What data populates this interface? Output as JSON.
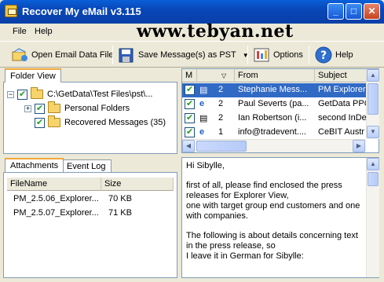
{
  "window": {
    "title": "Recover My eMail v3.115"
  },
  "watermark": "www.tebyan.net",
  "menu": {
    "file": "File",
    "help": "Help"
  },
  "toolbar": {
    "open": "Open Email Data File",
    "save": "Save Message(s) as PST",
    "options": "Options",
    "help": "Help"
  },
  "folder_view": {
    "tab": "Folder View",
    "items": [
      {
        "label": "C:\\GetData\\Test Files\\pst\\..."
      },
      {
        "label": "Personal Folders"
      },
      {
        "label": "Recovered Messages (35)"
      }
    ]
  },
  "messages": {
    "headers": {
      "m": "M",
      "flag": "",
      "from": "From",
      "subject": "Subject"
    },
    "rows": [
      {
        "count": "2",
        "from": "Stephanie Mess...",
        "subject": "PM Explorer",
        "icon": "document-icon",
        "selected": true
      },
      {
        "count": "2",
        "from": "Paul Severts (pa...",
        "subject": "GetData PPC",
        "icon": "ie-icon",
        "selected": false
      },
      {
        "count": "2",
        "from": "Ian Robertson (i...",
        "subject": "second InDe",
        "icon": "document-icon",
        "selected": false
      },
      {
        "count": "1",
        "from": "info@tradevent....",
        "subject": "CeBIT Austr",
        "icon": "ie-icon",
        "selected": false
      }
    ]
  },
  "attachments": {
    "tabs": [
      "Attachments",
      "Event Log"
    ],
    "headers": {
      "filename": "FileName",
      "size": "Size"
    },
    "rows": [
      {
        "filename": "PM_2.5.06_Explorer...",
        "size": "70 KB"
      },
      {
        "filename": "PM_2.5.07_Explorer...",
        "size": "71 KB"
      }
    ]
  },
  "preview": {
    "lines": [
      "Hi Sibylle,",
      "",
      "first of all, please find enclosed the press",
      "releases for Explorer View,",
      "one with target group end customers and one",
      "with companies.",
      "",
      "The following is about details concerning text",
      "in the press release, so",
      "I leave it in German for Sibylle:"
    ]
  },
  "colors": {
    "titlebar": "#0a4fc8",
    "selection": "#316ac5",
    "tab_accent": "#f1a83b"
  }
}
